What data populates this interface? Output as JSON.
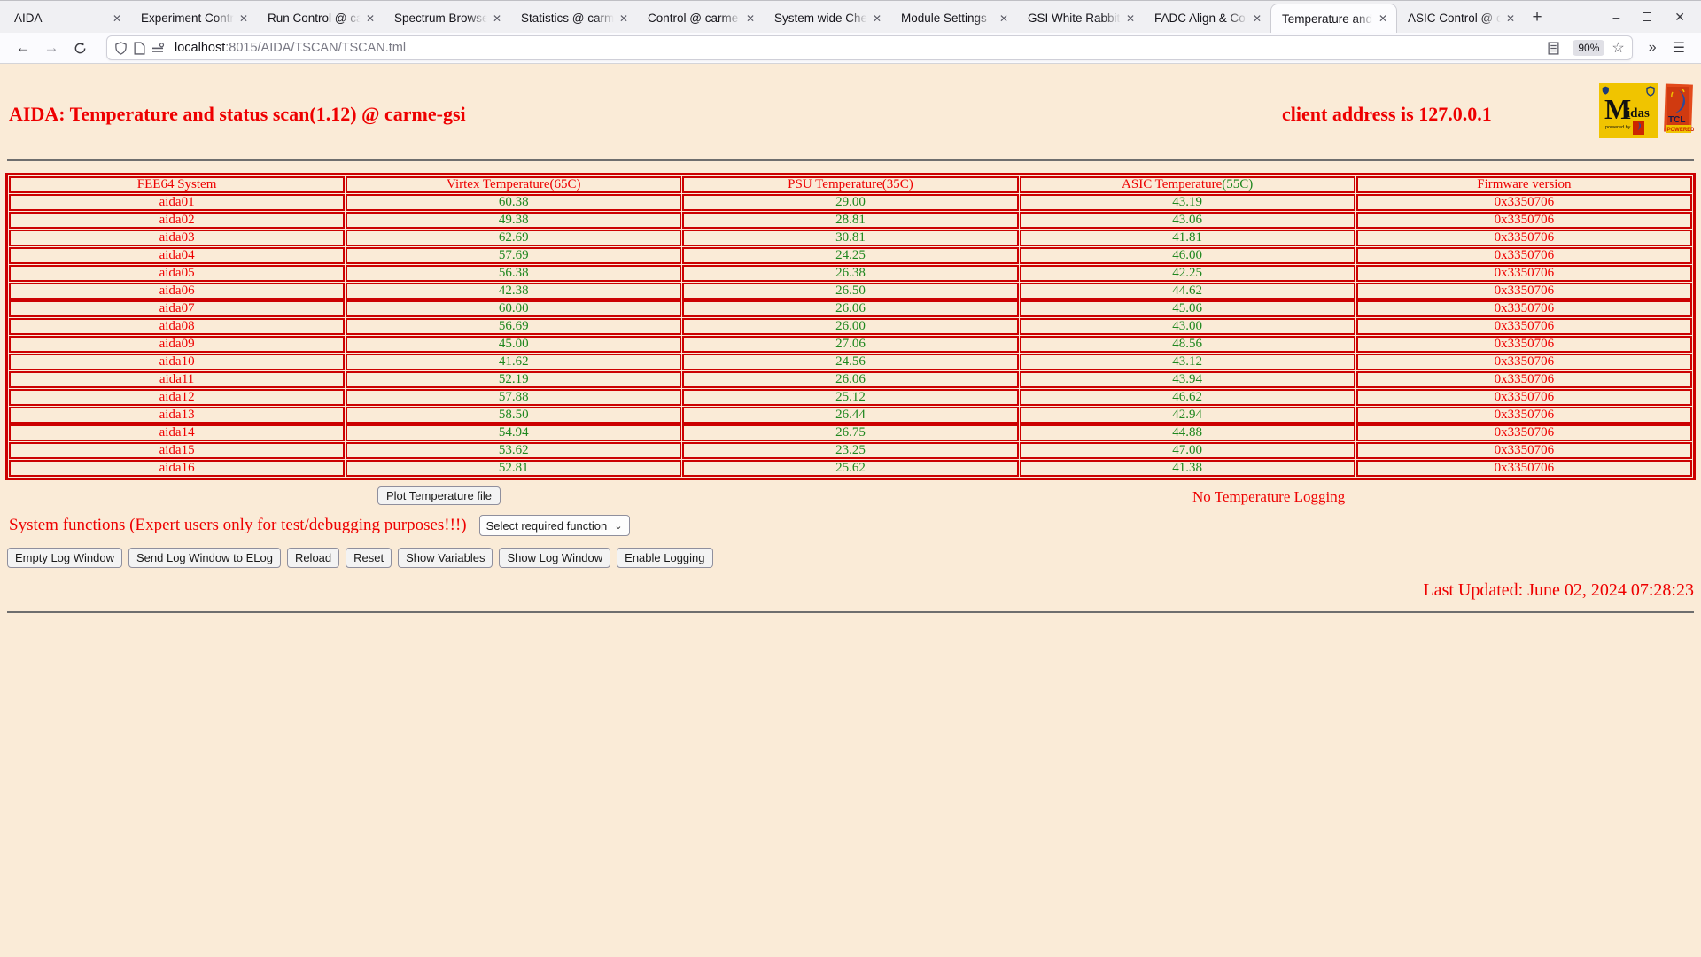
{
  "browser": {
    "tabs": [
      {
        "label": "AIDA",
        "active": false
      },
      {
        "label": "Experiment Contr",
        "active": false
      },
      {
        "label": "Run Control @ ca",
        "active": false
      },
      {
        "label": "Spectrum Browse",
        "active": false
      },
      {
        "label": "Statistics @ carm",
        "active": false
      },
      {
        "label": "Control @ carme",
        "active": false
      },
      {
        "label": "System wide Che",
        "active": false
      },
      {
        "label": "Module Settings",
        "active": false
      },
      {
        "label": "GSI White Rabbit",
        "active": false
      },
      {
        "label": "FADC Align & Co",
        "active": false
      },
      {
        "label": "Temperature and",
        "active": true
      },
      {
        "label": "ASIC Control @ c",
        "active": false
      }
    ],
    "close_glyph": "✕",
    "new_tab_glyph": "+",
    "back_glyph": "←",
    "forward_glyph": "→",
    "url_host": "localhost",
    "url_path": ":8015/AIDA/TSCAN/TSCAN.tml",
    "zoom_badge": "90%",
    "star_glyph": "☆",
    "overflow_glyph": "»",
    "menu_glyph": "☰",
    "minimize_glyph": "–",
    "close_window_glyph": "✕"
  },
  "page": {
    "title": "AIDA: Temperature and status scan(1.12) @ carme-gsi",
    "client_address": "client address is 127.0.0.1",
    "midas_logo_text": "Midas",
    "midas_powered_text": "powered by",
    "tcl_logo_text": "TCL",
    "tcl_powered_text": "POWERED",
    "table": {
      "headers": [
        {
          "text": "FEE64 System",
          "limit": "",
          "limit_green": false
        },
        {
          "text": "Virtex Temperature",
          "limit": "(65C)",
          "limit_green": false
        },
        {
          "text": "PSU Temperature",
          "limit": "(35C)",
          "limit_green": false
        },
        {
          "text": "ASIC Temperature",
          "limit": "(55C)",
          "limit_green": true
        },
        {
          "text": "Firmware version",
          "limit": "",
          "limit_green": false
        }
      ],
      "rows": [
        {
          "system": "aida01",
          "virtex": "60.38",
          "psu": "29.00",
          "asic": "43.19",
          "firmware": "0x3350706"
        },
        {
          "system": "aida02",
          "virtex": "49.38",
          "psu": "28.81",
          "asic": "43.06",
          "firmware": "0x3350706"
        },
        {
          "system": "aida03",
          "virtex": "62.69",
          "psu": "30.81",
          "asic": "41.81",
          "firmware": "0x3350706"
        },
        {
          "system": "aida04",
          "virtex": "57.69",
          "psu": "24.25",
          "asic": "46.00",
          "firmware": "0x3350706"
        },
        {
          "system": "aida05",
          "virtex": "56.38",
          "psu": "26.38",
          "asic": "42.25",
          "firmware": "0x3350706"
        },
        {
          "system": "aida06",
          "virtex": "42.38",
          "psu": "26.50",
          "asic": "44.62",
          "firmware": "0x3350706"
        },
        {
          "system": "aida07",
          "virtex": "60.00",
          "psu": "26.06",
          "asic": "45.06",
          "firmware": "0x3350706"
        },
        {
          "system": "aida08",
          "virtex": "56.69",
          "psu": "26.00",
          "asic": "43.00",
          "firmware": "0x3350706"
        },
        {
          "system": "aida09",
          "virtex": "45.00",
          "psu": "27.06",
          "asic": "48.56",
          "firmware": "0x3350706"
        },
        {
          "system": "aida10",
          "virtex": "41.62",
          "psu": "24.56",
          "asic": "43.12",
          "firmware": "0x3350706"
        },
        {
          "system": "aida11",
          "virtex": "52.19",
          "psu": "26.06",
          "asic": "43.94",
          "firmware": "0x3350706"
        },
        {
          "system": "aida12",
          "virtex": "57.88",
          "psu": "25.12",
          "asic": "46.62",
          "firmware": "0x3350706"
        },
        {
          "system": "aida13",
          "virtex": "58.50",
          "psu": "26.44",
          "asic": "42.94",
          "firmware": "0x3350706"
        },
        {
          "system": "aida14",
          "virtex": "54.94",
          "psu": "26.75",
          "asic": "44.88",
          "firmware": "0x3350706"
        },
        {
          "system": "aida15",
          "virtex": "53.62",
          "psu": "23.25",
          "asic": "47.00",
          "firmware": "0x3350706"
        },
        {
          "system": "aida16",
          "virtex": "52.81",
          "psu": "25.62",
          "asic": "41.38",
          "firmware": "0x3350706"
        }
      ]
    },
    "plot_button": "Plot Temperature file",
    "no_logging": "No Temperature Logging",
    "system_functions_label": "System functions (Expert users only for test/debugging purposes!!!)",
    "function_select_value": "Select required function",
    "log_buttons": [
      "Empty Log Window",
      "Send Log Window to ELog",
      "Reload",
      "Reset",
      "Show Variables",
      "Show Log Window",
      "Enable Logging"
    ],
    "last_updated": "Last Updated: June 02, 2024 07:28:23"
  },
  "colors": {
    "text_red": "#ee0000",
    "value_green": "#1e871e",
    "table_border": "#cc0000",
    "page_background": "#faebd7"
  }
}
